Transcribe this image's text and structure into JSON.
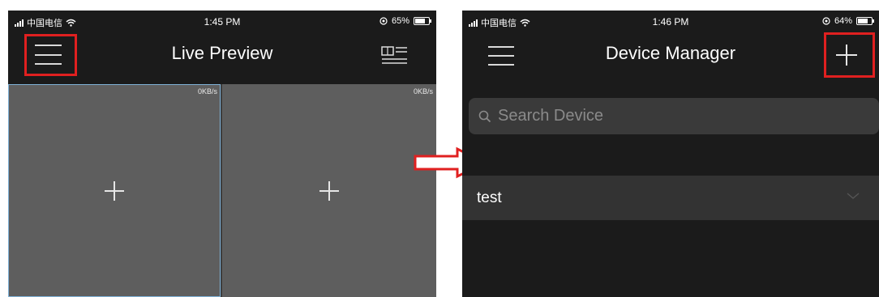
{
  "left_screen": {
    "status": {
      "carrier": "中国电信",
      "time": "1:45 PM",
      "battery": "65%",
      "battery_level": 0.65
    },
    "title": "Live Preview",
    "tiles": [
      {
        "speed": "0KB/s"
      },
      {
        "speed": "0KB/s"
      }
    ]
  },
  "right_screen": {
    "status": {
      "carrier": "中国电信",
      "time": "1:46 PM",
      "battery": "64%",
      "battery_level": 0.64
    },
    "title": "Device Manager",
    "search_placeholder": "Search Device",
    "devices": [
      {
        "name": "test"
      }
    ]
  },
  "colors": {
    "highlight": "#e02020",
    "background": "#1b1b1b",
    "tile": "#5e5e5e"
  },
  "icons": [
    "menu-icon",
    "record-list-icon",
    "add-icon",
    "search-icon",
    "chevron-down-icon",
    "arrow-right-icon",
    "wifi-icon",
    "battery-icon"
  ]
}
